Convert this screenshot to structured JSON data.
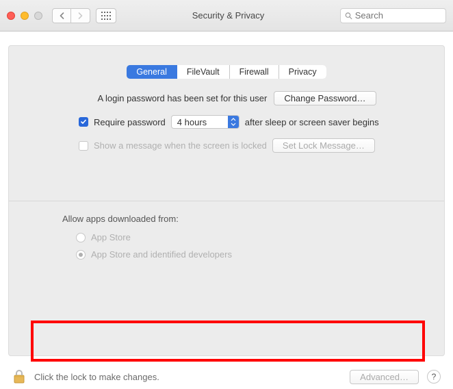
{
  "titlebar": {
    "title": "Security & Privacy",
    "search_placeholder": "Search"
  },
  "tabs": [
    {
      "id": "general",
      "label": "General",
      "selected": true
    },
    {
      "id": "filevault",
      "label": "FileVault",
      "selected": false
    },
    {
      "id": "firewall",
      "label": "Firewall",
      "selected": false
    },
    {
      "id": "privacy",
      "label": "Privacy",
      "selected": false
    }
  ],
  "login": {
    "password_set_text": "A login password has been set for this user",
    "change_password_btn": "Change Password…",
    "require_pw_label": "Require password",
    "require_pw_checked": true,
    "delay_value": "4 hours",
    "after_text": "after sleep or screen saver begins",
    "show_msg_label": "Show a message when the screen is locked",
    "show_msg_checked": false,
    "set_lock_btn": "Set Lock Message…"
  },
  "apps": {
    "title": "Allow apps downloaded from:",
    "options": [
      {
        "id": "appstore",
        "label": "App Store",
        "selected": false
      },
      {
        "id": "identified",
        "label": "App Store and identified developers",
        "selected": true
      }
    ]
  },
  "footer": {
    "lock_text": "Click the lock to make changes.",
    "advanced_btn": "Advanced…",
    "help": "?"
  }
}
